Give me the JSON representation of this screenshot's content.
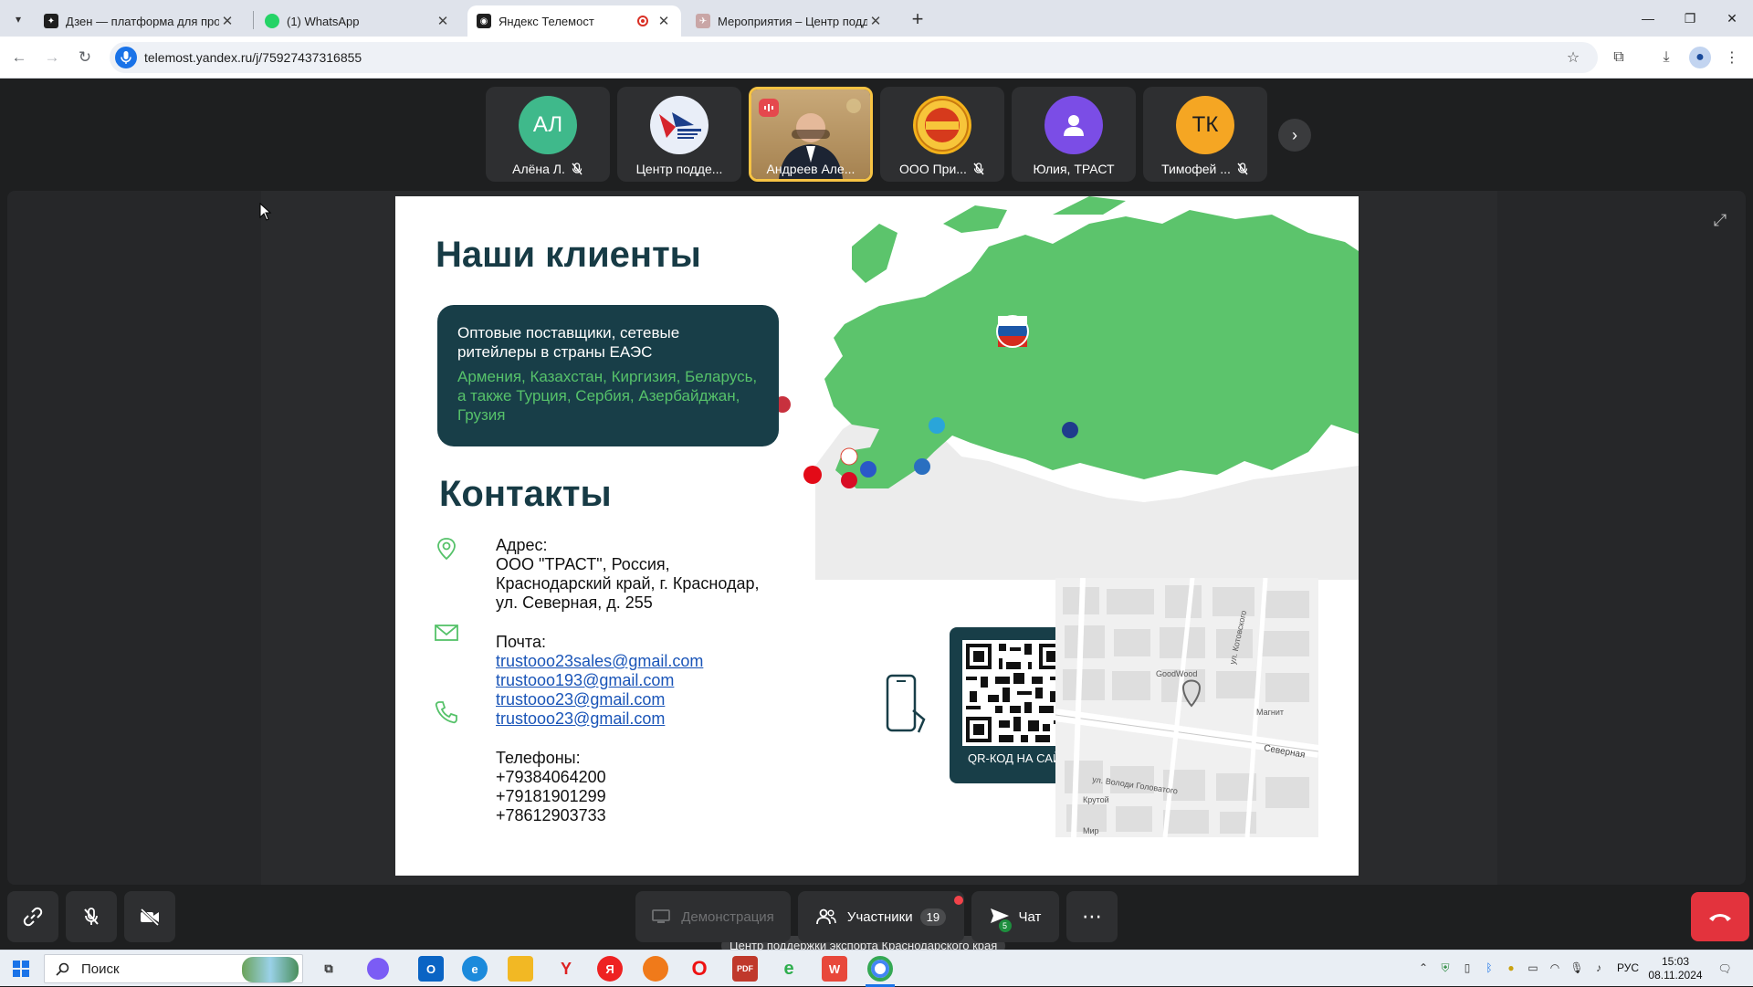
{
  "browser": {
    "tabs": [
      {
        "title": "Дзен — платформа для просм…",
        "favicon_color": "#1f1f1f"
      },
      {
        "title": "(1) WhatsApp",
        "favicon_color": "#25d366"
      },
      {
        "title": "Яндекс Телемост",
        "favicon_color": "#1f1f1f"
      },
      {
        "title": "Мероприятия – Центр поддер…",
        "favicon_color": "#d33"
      }
    ],
    "url": "telemost.yandex.ru/j/75927437316855"
  },
  "participants": [
    {
      "initials": "АЛ",
      "name": "Алёна Л.",
      "color": "#3fb98b",
      "muted": true
    },
    {
      "initials": "",
      "name": "Центр подде...",
      "color": "#1d3f8a",
      "muted": false
    },
    {
      "initials": "",
      "name": "Андреев Але...",
      "color": "#8a6a40",
      "muted": false
    },
    {
      "initials": "",
      "name": "ООО При...",
      "color": "#d89a1a",
      "muted": true
    },
    {
      "initials": "",
      "name": "Юлия, ТРАСТ",
      "color": "#7b4de6",
      "muted": false
    },
    {
      "initials": "ТК",
      "name": "Тимофей ...",
      "color": "#f5a623",
      "muted": true
    }
  ],
  "slide": {
    "clients_title": "Наши клиенты",
    "clients_line1": "Оптовые поставщики, сетевые ритейлеры в страны ЕАЭС",
    "clients_line2": "Армения, Казахстан, Киргизия, Беларусь, а также Турция, Сербия, Азербайджан, Грузия",
    "contacts_title": "Контакты",
    "address_label": "Адрес:",
    "address_lines": [
      "ООО \"ТРАСТ\", Россия,",
      "Краснодарский край, г. Краснодар,",
      "ул. Северная, д. 255"
    ],
    "mail_label": "Почта:",
    "emails": [
      "trustooo23sales@gmail.com",
      "trustooo193@gmail.com",
      "trustooo23@gmail.com",
      "trustooo23@gmail.com"
    ],
    "phones_label": "Телефоны:",
    "phones": [
      "+79384064200",
      "+79181901299",
      "+78612903733"
    ],
    "qr_caption": "QR-КОД НА САЙТ",
    "map_labels": [
      "Северная",
      "GoodWood",
      "Магнит",
      "Крутой",
      "Мир",
      "ул. Котовского",
      "ул. Володи Головатого"
    ],
    "colors": {
      "dark": "#183e48",
      "green": "#56c26a",
      "map_green": "#5cc46c"
    }
  },
  "presenter_caption": "Центр поддержки экспорта Краснодарского края",
  "controls": {
    "demo_label": "Демонстрация",
    "participants_label": "Участники",
    "participants_count": "19",
    "chat_label": "Чат",
    "chat_badge": "5"
  },
  "taskbar": {
    "search_label": "Поиск",
    "lang": "РУС",
    "time": "15:03",
    "date": "08.11.2024"
  }
}
